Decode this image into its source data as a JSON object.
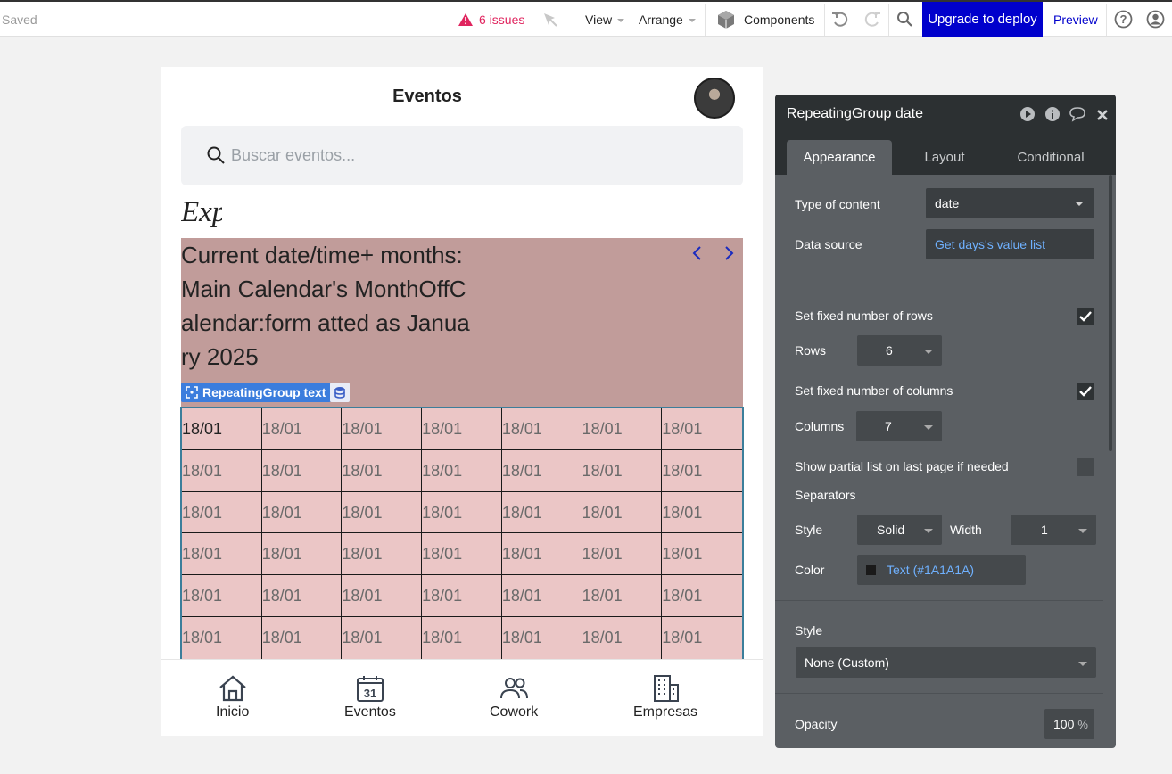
{
  "topbar": {
    "saved": "Saved",
    "issues": "6 issues",
    "view": "View",
    "arrange": "Arrange",
    "components": "Components",
    "upgrade": "Upgrade to deploy",
    "preview": "Preview"
  },
  "app": {
    "title": "Eventos",
    "search_placeholder": "Buscar eventos...",
    "exp_text": "Exp",
    "header_text": "Current date/time+ months: Main Calendar's MonthOffCalendar:form atted as January 2025",
    "repeating_tag": "RepeatingGroup text",
    "cells": [
      [
        "18/01",
        "18/01",
        "18/01",
        "18/01",
        "18/01",
        "18/01",
        "18/01"
      ],
      [
        "18/01",
        "18/01",
        "18/01",
        "18/01",
        "18/01",
        "18/01",
        "18/01"
      ],
      [
        "18/01",
        "18/01",
        "18/01",
        "18/01",
        "18/01",
        "18/01",
        "18/01"
      ],
      [
        "18/01",
        "18/01",
        "18/01",
        "18/01",
        "18/01",
        "18/01",
        "18/01"
      ],
      [
        "18/01",
        "18/01",
        "18/01",
        "18/01",
        "18/01",
        "18/01",
        "18/01"
      ],
      [
        "18/01",
        "18/01",
        "18/01",
        "18/01",
        "18/01",
        "18/01",
        "18/01"
      ]
    ],
    "tabs": [
      {
        "label": "Inicio",
        "icon": "home-icon"
      },
      {
        "label": "Eventos",
        "icon": "calendar-icon",
        "calendar_day": "31"
      },
      {
        "label": "Cowork",
        "icon": "users-icon"
      },
      {
        "label": "Empresas",
        "icon": "building-icon"
      }
    ]
  },
  "panel": {
    "title": "RepeatingGroup date",
    "tabs": [
      "Appearance",
      "Layout",
      "Conditional"
    ],
    "active_tab": "Appearance",
    "type_of_content_label": "Type of content",
    "type_of_content_value": "date",
    "data_source_label": "Data source",
    "data_source_value": "Get days's value list",
    "fixed_rows_label": "Set fixed number of rows",
    "fixed_rows_checked": true,
    "rows_label": "Rows",
    "rows_value": "6",
    "fixed_columns_label": "Set fixed number of columns",
    "fixed_columns_checked": true,
    "columns_label": "Columns",
    "columns_value": "7",
    "partial_list_label": "Show partial list on last page if needed",
    "partial_list_checked": false,
    "separators_label": "Separators",
    "style_label": "Style",
    "style_value": "Solid",
    "width_label": "Width",
    "width_value": "1",
    "color_label": "Color",
    "color_value": "Text (#1A1A1A)",
    "color_swatch": "#1A1A1A",
    "style2_label": "Style",
    "style2_value": "None (Custom)",
    "opacity_label": "Opacity",
    "opacity_value": "100",
    "opacity_unit": "%"
  },
  "colors": {
    "accent_blue": "#0000cc",
    "issues_red": "#e0245e",
    "header_group_bg": "#c19c9a",
    "grid_bg": "#ebc6c6",
    "panel_bg": "#5b5f63",
    "panel_header_bg": "#2c3032",
    "link_blue": "#6fb1ff"
  }
}
